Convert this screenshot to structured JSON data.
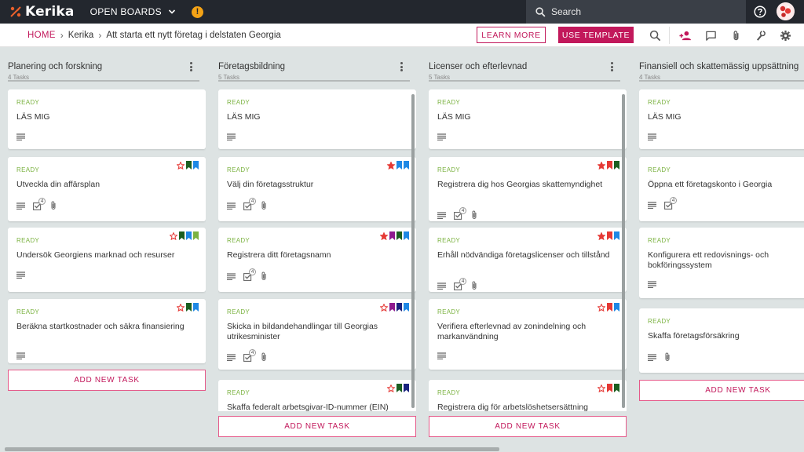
{
  "app": {
    "logo_text": "Kerika",
    "open_boards_label": "OPEN BOARDS",
    "notification_badge": "!",
    "search_placeholder": "Search"
  },
  "breadcrumb": {
    "home": "HOME",
    "org": "Kerika",
    "board": "Att starta ett nytt företag i delstaten Georgia"
  },
  "toolbar": {
    "learn_more": "LEARN MORE",
    "use_template": "USE TEMPLATE"
  },
  "colors": {
    "accent": "#c2185b",
    "ready": "#7cb342",
    "topbar": "#23272e",
    "star_red": "#e53935",
    "flag_red": "#e53935",
    "flag_darkgreen": "#1b5e20",
    "flag_blue": "#1e88e5",
    "flag_purple": "#8e1a8e",
    "flag_navy": "#1a237e",
    "flag_lightgreen": "#7cb342"
  },
  "columns": [
    {
      "title": "Planering och forskning",
      "count": "4 Tasks",
      "add_label": "ADD NEW TASK",
      "cards": [
        {
          "status": "READY",
          "title": "LÄS MIG",
          "star": "none",
          "flags": [],
          "desc": true,
          "checklist": "",
          "attach": false
        },
        {
          "status": "READY",
          "title": "Utveckla din affärsplan",
          "star": "outline",
          "flags": [
            "darkgreen",
            "blue"
          ],
          "desc": true,
          "checklist": "4",
          "attach": true
        },
        {
          "status": "READY",
          "title": "Undersök Georgiens marknad och resurser",
          "star": "outline",
          "flags": [
            "darkgreen",
            "blue",
            "lightgreen"
          ],
          "desc": true,
          "checklist": "",
          "attach": false
        },
        {
          "status": "READY",
          "title": "Beräkna startkostnader och säkra finansiering",
          "star": "outline",
          "flags": [
            "darkgreen",
            "blue"
          ],
          "desc": true,
          "checklist": "",
          "attach": false
        }
      ]
    },
    {
      "title": "Företagsbildning",
      "count": "5 Tasks",
      "add_label": "ADD NEW TASK",
      "cards": [
        {
          "status": "READY",
          "title": "LÄS MIG",
          "star": "none",
          "flags": [],
          "desc": true,
          "checklist": "",
          "attach": false
        },
        {
          "status": "READY",
          "title": "Välj din företagsstruktur",
          "star": "filled",
          "flags": [
            "blue",
            "blue"
          ],
          "desc": true,
          "checklist": "4",
          "attach": true
        },
        {
          "status": "READY",
          "title": "Registrera ditt företagsnamn",
          "star": "filled",
          "flags": [
            "purple",
            "darkgreen",
            "blue"
          ],
          "desc": true,
          "checklist": "4",
          "attach": true
        },
        {
          "status": "READY",
          "title": "Skicka in bildandehandlingar till Georgias utrikesminister",
          "star": "outline",
          "flags": [
            "purple",
            "navy",
            "blue"
          ],
          "desc": true,
          "checklist": "4",
          "attach": true
        },
        {
          "status": "READY",
          "title": "Skaffa federalt arbetsgivar-ID-nummer (EIN)",
          "star": "outline",
          "flags": [
            "darkgreen",
            "navy"
          ],
          "desc": false,
          "checklist": "",
          "attach": false
        }
      ]
    },
    {
      "title": "Licenser och efterlevnad",
      "count": "5 Tasks",
      "add_label": "ADD NEW TASK",
      "cards": [
        {
          "status": "READY",
          "title": "LÄS MIG",
          "star": "none",
          "flags": [],
          "desc": true,
          "checklist": "",
          "attach": false
        },
        {
          "status": "READY",
          "title": "Registrera dig hos Georgias skattemyndighet",
          "star": "filled",
          "flags": [
            "red",
            "darkgreen"
          ],
          "desc": true,
          "checklist": "4",
          "attach": true
        },
        {
          "status": "READY",
          "title": "Erhåll nödvändiga företagslicenser och tillstånd",
          "star": "filled",
          "flags": [
            "red",
            "blue"
          ],
          "desc": true,
          "checklist": "4",
          "attach": true
        },
        {
          "status": "READY",
          "title": "Verifiera efterlevnad av zonindelning och markanvändning",
          "star": "outline",
          "flags": [
            "red",
            "blue"
          ],
          "desc": true,
          "checklist": "",
          "attach": false
        },
        {
          "status": "READY",
          "title": "Registrera dig för arbetslöshetsersättning",
          "star": "outline",
          "flags": [
            "red",
            "darkgreen"
          ],
          "desc": false,
          "checklist": "",
          "attach": false
        }
      ]
    },
    {
      "title": "Finansiell och skattemässig uppsättning",
      "count": "4 Tasks",
      "add_label": "ADD NEW TASK",
      "cards": [
        {
          "status": "READY",
          "title": "LÄS MIG",
          "star": "none",
          "flags": [],
          "desc": true,
          "checklist": "",
          "attach": false
        },
        {
          "status": "READY",
          "title": "Öppna ett företagskonto i Georgia",
          "star": "none",
          "flags": [],
          "desc": true,
          "checklist": "4",
          "attach": false
        },
        {
          "status": "READY",
          "title": "Konfigurera ett redovisnings- och bokföringssystem",
          "star": "none",
          "flags": [],
          "desc": true,
          "checklist": "",
          "attach": false
        },
        {
          "status": "READY",
          "title": "Skaffa företagsförsäkring",
          "star": "none",
          "flags": [],
          "desc": true,
          "checklist": "",
          "attach": true
        }
      ]
    }
  ]
}
